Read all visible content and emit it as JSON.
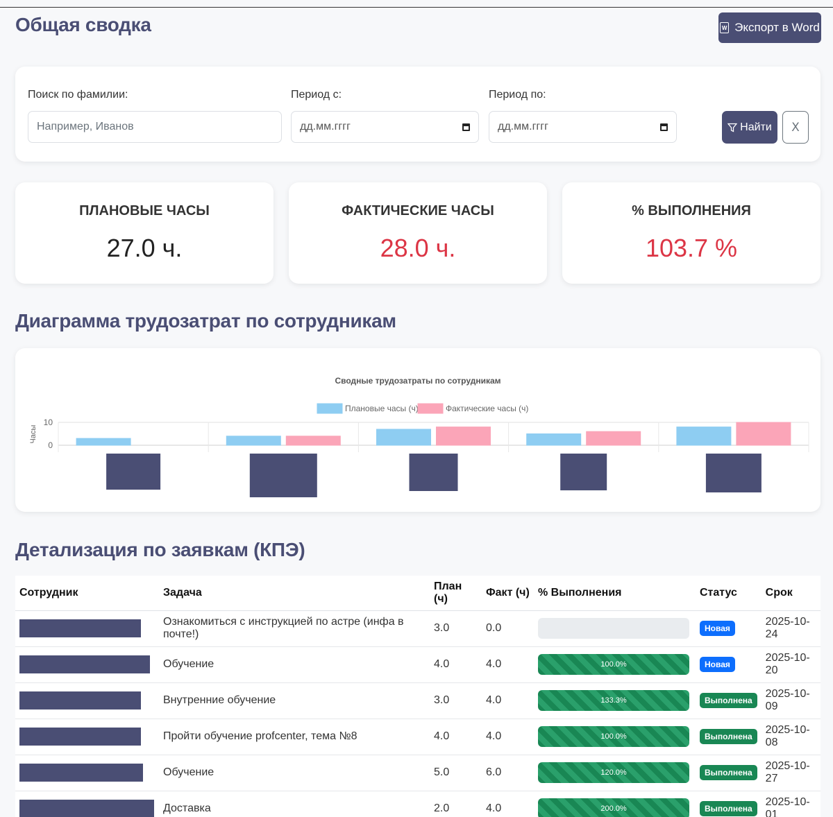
{
  "header": {
    "title": "Общая сводка",
    "export_label": "Экспорт в Word"
  },
  "filters": {
    "surname_label": "Поиск по фамилии:",
    "surname_placeholder": "Например, Иванов",
    "from_label": "Период с:",
    "from_placeholder": "дд.мм.гггг",
    "to_label": "Период по:",
    "to_placeholder": "дд.мм.гггг",
    "find_label": "Найти",
    "clear_label": "X"
  },
  "stats": {
    "planned_label": "ПЛАНОВЫЕ ЧАСЫ",
    "planned_value": "27.0 ч.",
    "actual_label": "ФАКТИЧЕСКИЕ ЧАСЫ",
    "actual_value": "28.0 ч.",
    "percent_label": "% ВЫПОЛНЕНИЯ",
    "percent_value": "103.7 %"
  },
  "chart_section_title": "Диаграмма трудозатрат по сотрудникам",
  "chart_data": {
    "type": "bar",
    "title": "Сводные трудозатраты по сотрудникам",
    "ylabel": "Часы",
    "ylim": [
      0,
      10
    ],
    "yticks": [
      0,
      10
    ],
    "categories": [
      "",
      "",
      "",
      "",
      ""
    ],
    "series": [
      {
        "name": "Плановые часы (ч)",
        "color": "#8ecdf2",
        "values": [
          3,
          4,
          7,
          5,
          8
        ]
      },
      {
        "name": "Фактические часы (ч)",
        "color": "#fba5b8",
        "values": [
          0,
          4,
          8,
          6,
          10
        ]
      }
    ]
  },
  "table_section_title": "Детализация по заявкам (КПЭ)",
  "table": {
    "headers": {
      "employee": "Сотрудник",
      "task": "Задача",
      "plan": "План (ч)",
      "fact": "Факт (ч)",
      "percent": "% Выполнения",
      "status": "Статус",
      "due": "Срок"
    },
    "rows": [
      {
        "task": "Ознакомиться с инструкцией по астре (инфа в почте!)",
        "plan": "3.0",
        "fact": "0.0",
        "percent": "",
        "progress": 0,
        "status": "Новая",
        "status_color": "#0d6efd",
        "due": "2025-10-24"
      },
      {
        "task": "Обучение",
        "plan": "4.0",
        "fact": "4.0",
        "percent": "100.0%",
        "progress": 100,
        "status": "Новая",
        "status_color": "#0d6efd",
        "due": "2025-10-20"
      },
      {
        "task": "Внутренние обучение",
        "plan": "3.0",
        "fact": "4.0",
        "percent": "133.3%",
        "progress": 100,
        "status": "Выполнена",
        "status_color": "#198754",
        "due": "2025-10-09"
      },
      {
        "task": "Пройти обучение profcenter, тема №8",
        "plan": "4.0",
        "fact": "4.0",
        "percent": "100.0%",
        "progress": 100,
        "status": "Выполнена",
        "status_color": "#198754",
        "due": "2025-10-08"
      },
      {
        "task": "Обучение",
        "plan": "5.0",
        "fact": "6.0",
        "percent": "120.0%",
        "progress": 100,
        "status": "Выполнена",
        "status_color": "#198754",
        "due": "2025-10-27"
      },
      {
        "task": "Доставка",
        "plan": "2.0",
        "fact": "4.0",
        "percent": "200.0%",
        "progress": 100,
        "status": "Выполнена",
        "status_color": "#198754",
        "due": "2025-10-01"
      }
    ]
  }
}
